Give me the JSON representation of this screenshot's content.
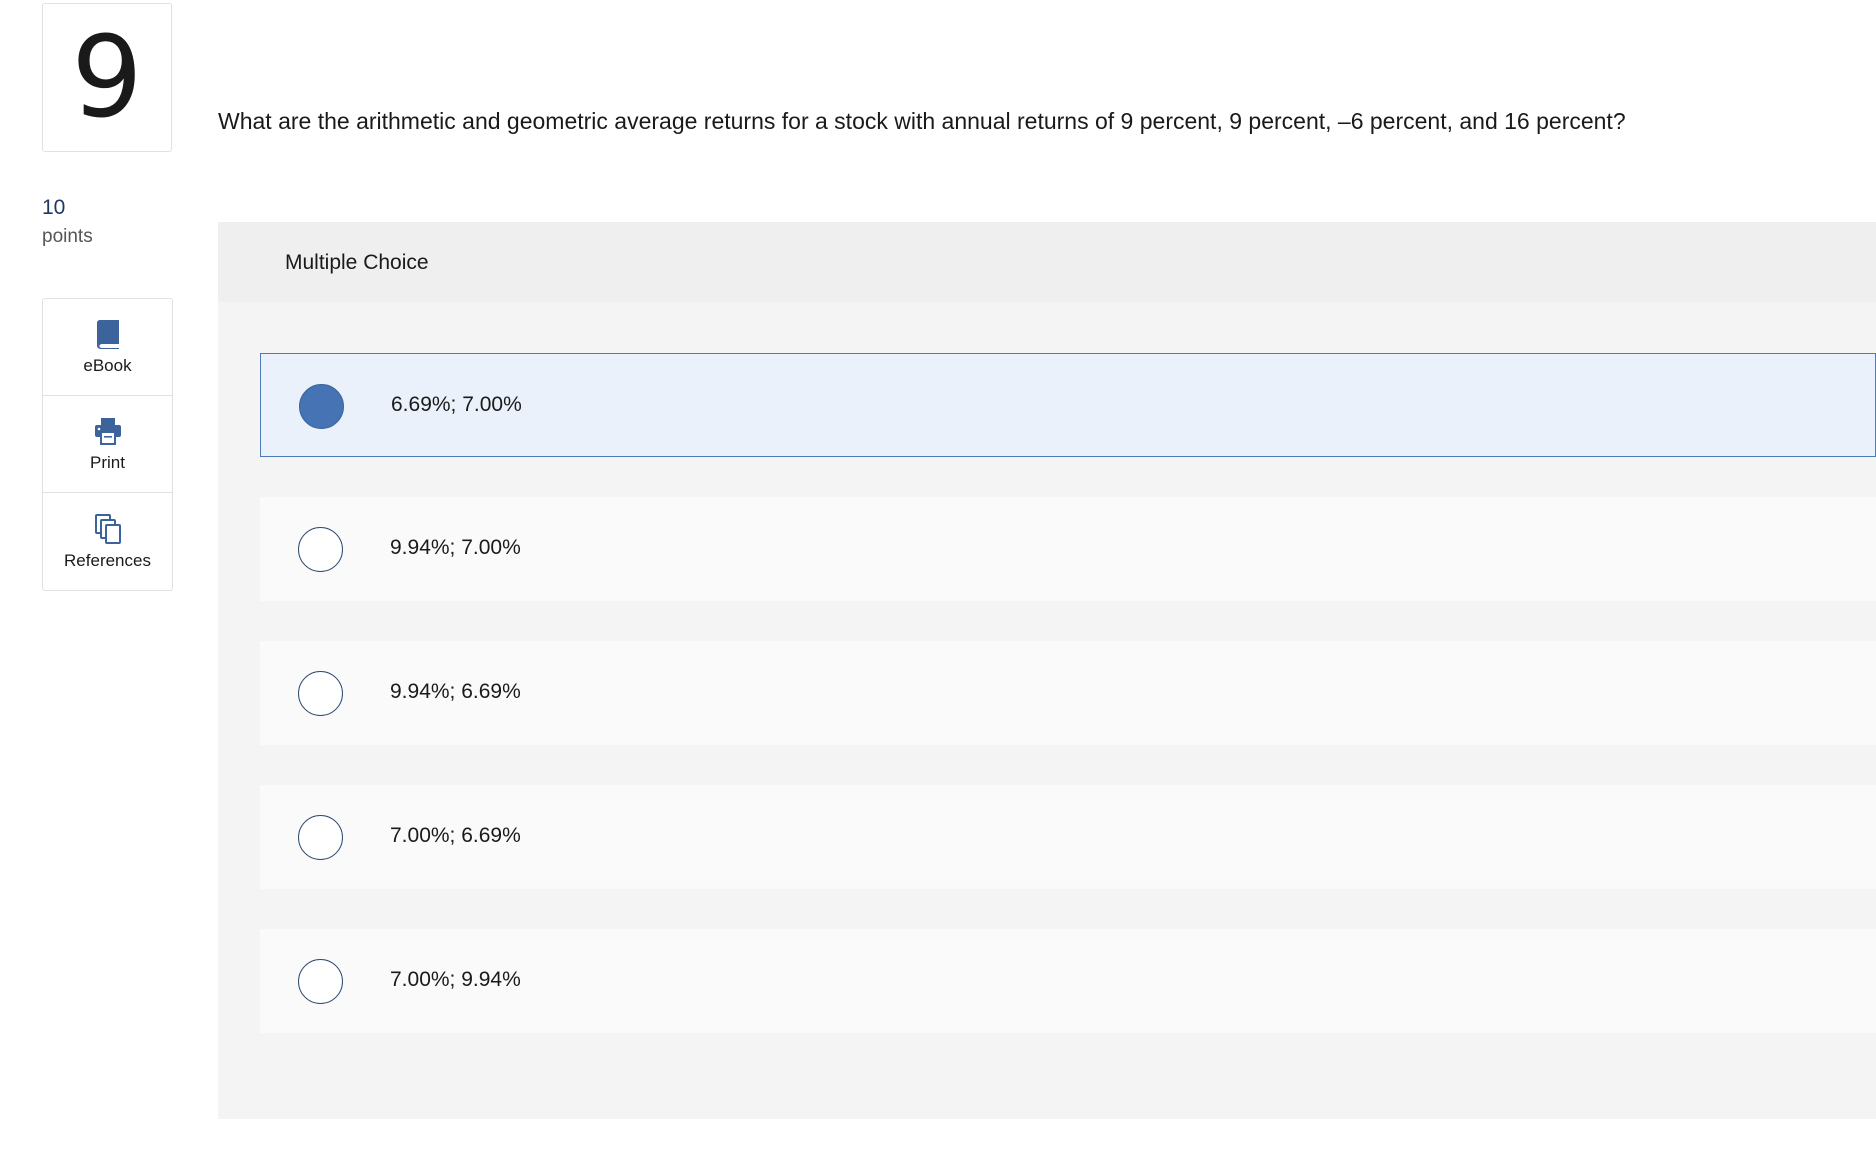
{
  "question": {
    "number": "9",
    "points_value": "10",
    "points_label": "points",
    "text": "What are the arithmetic and geometric average returns for a stock with annual returns of 9 percent, 9 percent, –6 percent, and 16 percent?"
  },
  "tools": [
    {
      "label": "eBook",
      "icon": "book-icon"
    },
    {
      "label": "Print",
      "icon": "printer-icon"
    },
    {
      "label": "References",
      "icon": "copy-documents-icon"
    }
  ],
  "answer_panel": {
    "title": "Multiple Choice",
    "choices": [
      {
        "text": "6.69%; 7.00%",
        "selected": true
      },
      {
        "text": "9.94%; 7.00%",
        "selected": false
      },
      {
        "text": "9.94%; 6.69%",
        "selected": false
      },
      {
        "text": "7.00%; 6.69%",
        "selected": false
      },
      {
        "text": "7.00%; 9.94%",
        "selected": false
      }
    ]
  },
  "colors": {
    "accent": "#4673b3",
    "selected_bg": "#eaf1fa",
    "points_text": "#1f3a60"
  }
}
